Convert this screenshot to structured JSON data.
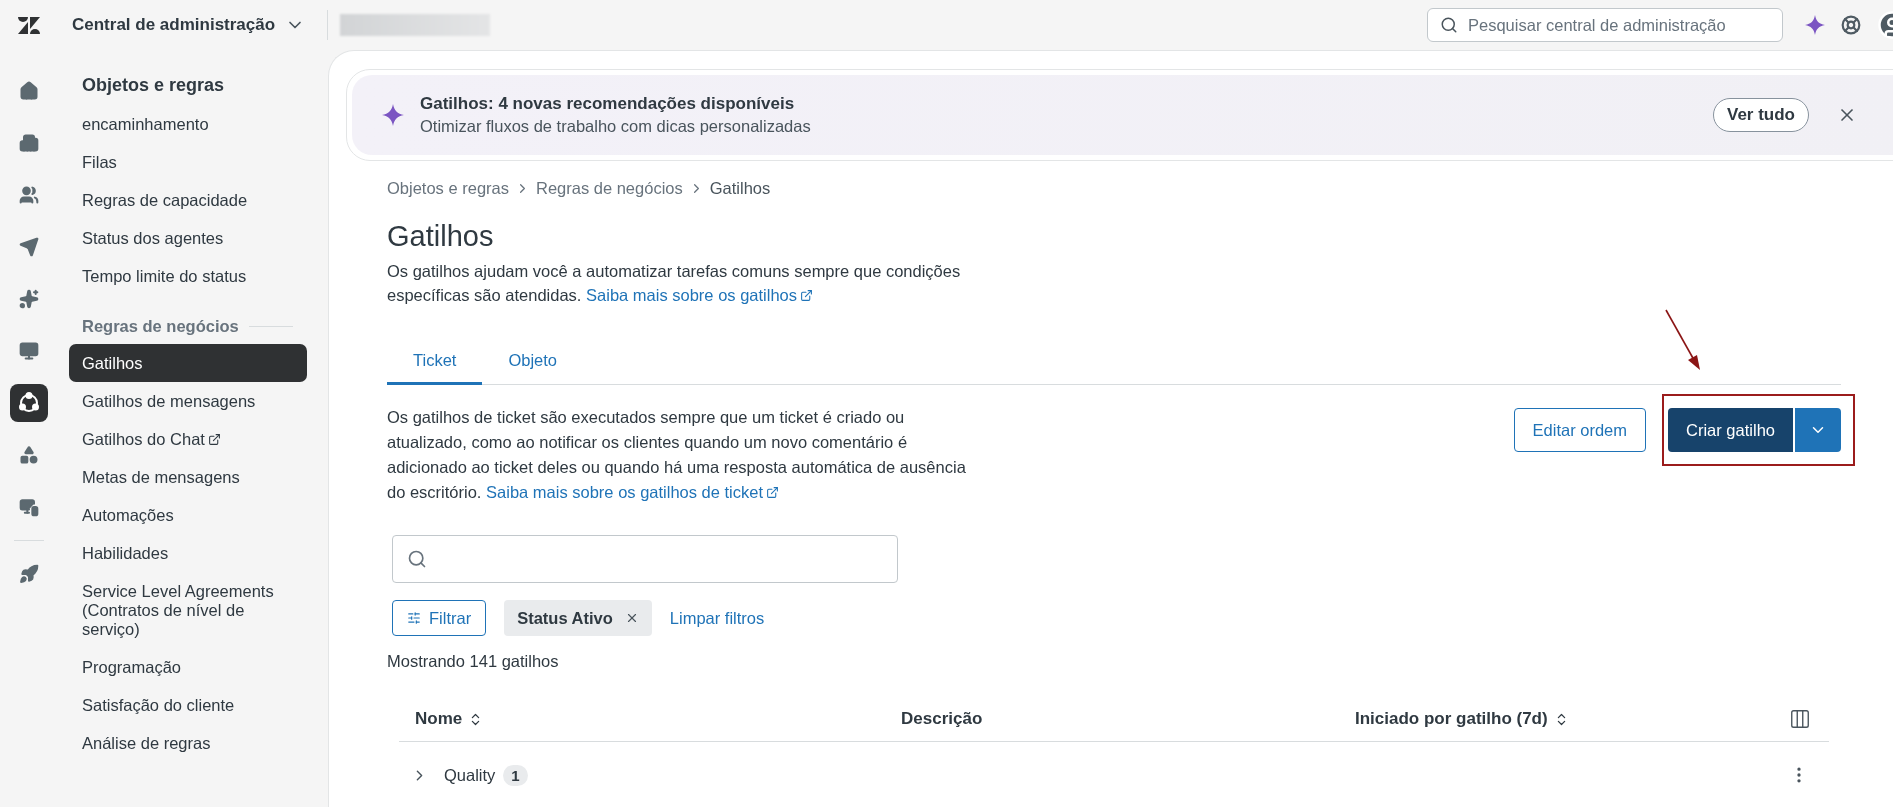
{
  "top_bar": {
    "product": "Central de administração",
    "search": {
      "placeholder": "Pesquisar central de administração"
    }
  },
  "rail": {
    "items": [
      {
        "selected": false
      },
      {
        "selected": false
      },
      {
        "selected": false
      },
      {
        "selected": false
      },
      {
        "selected": false
      },
      {
        "selected": false
      },
      {
        "selected": true
      },
      {
        "selected": false
      },
      {
        "selected": false
      },
      {
        "selected": false
      }
    ]
  },
  "sidebar": {
    "title": "Objetos e regras",
    "items": [
      {
        "label": "encaminhamento",
        "selected": false
      },
      {
        "label": "Filas",
        "selected": false
      },
      {
        "label": "Regras de capacidade",
        "selected": false
      },
      {
        "label": "Status dos agentes",
        "selected": false
      },
      {
        "label": "Tempo limite do status",
        "selected": false
      }
    ],
    "groups": [
      {
        "title": "Regras de negócios",
        "items": [
          {
            "label": "Gatilhos",
            "selected": true,
            "external": false
          },
          {
            "label": "Gatilhos de mensagens",
            "selected": false,
            "external": false
          },
          {
            "label": "Gatilhos do Chat",
            "selected": false,
            "external": true
          },
          {
            "label": "Metas de mensagens",
            "selected": false,
            "external": false
          },
          {
            "label": "Automações",
            "selected": false,
            "external": false
          },
          {
            "label": "Habilidades",
            "selected": false,
            "external": false
          },
          {
            "label": "Service Level Agreements (Contratos de nível de serviço)",
            "selected": false,
            "external": false
          },
          {
            "label": "Programação",
            "selected": false,
            "external": false
          },
          {
            "label": "Satisfação do cliente",
            "selected": false,
            "external": false
          },
          {
            "label": "Análise de regras",
            "selected": false,
            "external": false
          }
        ]
      }
    ]
  },
  "banner": {
    "title": "Gatilhos: 4 novas recomendações disponíveis",
    "subtitle": "Otimizar fluxos de trabalho com dicas personalizadas",
    "button": "Ver tudo"
  },
  "breadcrumb": [
    "Objetos e regras",
    "Regras de negócios",
    "Gatilhos"
  ],
  "page": {
    "title": "Gatilhos",
    "description": "Os gatilhos ajudam você a automatizar tarefas comuns sempre que condições específicas são atendidas.",
    "link": "Saiba mais sobre os gatilhos"
  },
  "tabs": [
    {
      "label": "Ticket",
      "selected": true
    },
    {
      "label": "Objeto",
      "selected": false
    }
  ],
  "tab_description": {
    "text": "Os gatilhos de ticket são executados sempre que um ticket é criado ou atualizado, como ao notificar os clientes quando um novo comentário é adicionado ao ticket deles ou quando há uma resposta automática de ausência do escritório.",
    "link": "Saiba mais sobre os gatilhos de ticket"
  },
  "actions": {
    "secondary": "Editar ordem",
    "primary": "Criar gatilho"
  },
  "filters": {
    "button": "Filtrar",
    "chips": [
      {
        "label": "Status Ativo"
      }
    ],
    "clear": "Limpar filtros"
  },
  "count": "Mostrando 141 gatilhos",
  "table": {
    "columns": [
      {
        "label": "Nome",
        "sortable": true
      },
      {
        "label": "Descrição",
        "sortable": false
      },
      {
        "label": "Iniciado por gatilho (7d)",
        "sortable": true
      }
    ],
    "rows": [
      {
        "name": "Quality",
        "count": "1",
        "expanded": false
      }
    ]
  }
}
